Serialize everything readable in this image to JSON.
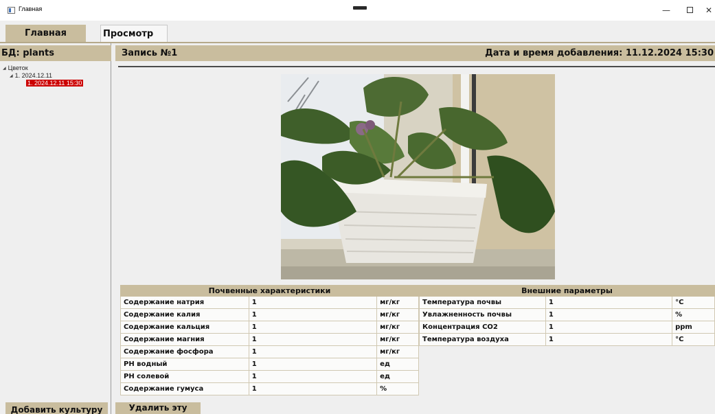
{
  "window": {
    "title": "Главная",
    "minimize_glyph": "—",
    "close_glyph": "✕"
  },
  "tabs": [
    {
      "label": "Главная",
      "active": false
    },
    {
      "label": "Просмотр",
      "active": true
    }
  ],
  "sidebar": {
    "db_label": "БД: plants",
    "tree": [
      {
        "label": "Цветок",
        "expanded": true,
        "level": 0
      },
      {
        "label": "1. 2024.12.11",
        "expanded": true,
        "level": 1
      },
      {
        "label": "1. 2024.12.11 15:30",
        "selected": true,
        "level": 2
      }
    ],
    "add_button": "Добавить культуру"
  },
  "record": {
    "title": "Запись №1",
    "date_label": "Дата и время добавления: 11.12.2024 15:30",
    "photo_icon": "potted-plant-photo"
  },
  "soil": {
    "header": "Почвенные характеристики",
    "rows": [
      {
        "name": "Содержание натрия",
        "value": "1",
        "unit": "мг/кг"
      },
      {
        "name": "Содержание калия",
        "value": "1",
        "unit": "мг/кг"
      },
      {
        "name": "Содержание кальция",
        "value": "1",
        "unit": "мг/кг"
      },
      {
        "name": "Содержание магния",
        "value": "1",
        "unit": "мг/кг"
      },
      {
        "name": "Содержание фосфора",
        "value": "1",
        "unit": "мг/кг"
      },
      {
        "name": "PH водный",
        "value": "1",
        "unit": "ед"
      },
      {
        "name": "PH солевой",
        "value": "1",
        "unit": "ед"
      },
      {
        "name": "Содержание гумуса",
        "value": "1",
        "unit": "%"
      }
    ]
  },
  "external": {
    "header": "Внешние параметры",
    "rows": [
      {
        "name": "Температура почвы",
        "value": "1",
        "unit": "°C"
      },
      {
        "name": "Увлажненность почвы",
        "value": "1",
        "unit": "%"
      },
      {
        "name": "Концентрация CO2",
        "value": "1",
        "unit": "ppm"
      },
      {
        "name": "Температура воздуха",
        "value": "1",
        "unit": "°C"
      }
    ]
  },
  "actions": {
    "delete_button": "Удалить эту запись"
  },
  "colors": {
    "accent": "#c9bd9e",
    "selection": "#cc0000",
    "background": "#efefef"
  }
}
